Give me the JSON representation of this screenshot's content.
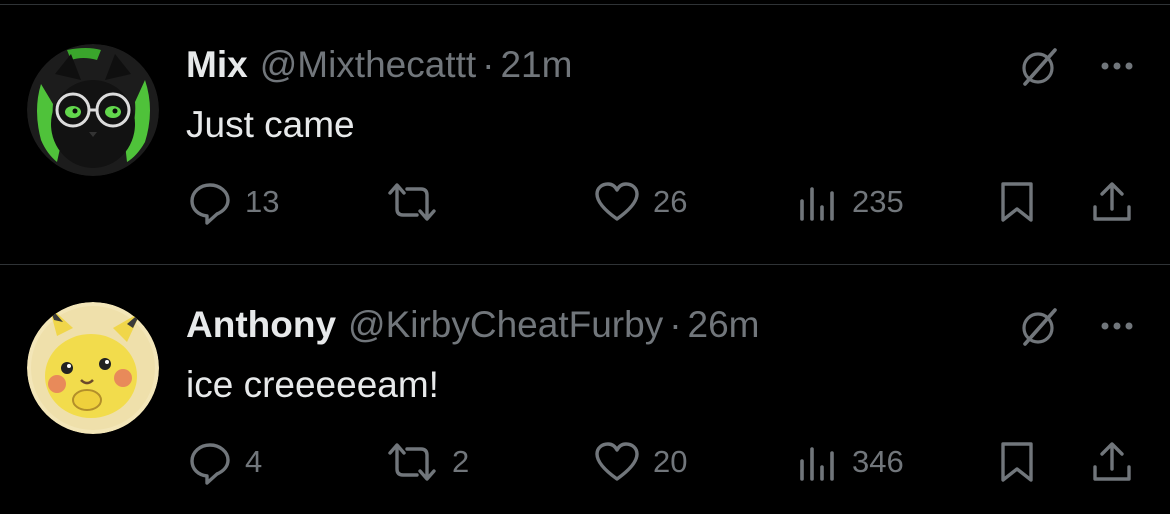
{
  "colors": {
    "background": "#000000",
    "text_primary": "#e7e9ea",
    "text_secondary": "#71767b",
    "divider": "#2f3336"
  },
  "tweets": [
    {
      "display_name": "Mix",
      "handle": "@Mixthecattt",
      "separator": "·",
      "time": "21m",
      "text": "Just came",
      "avatar": "black-cat-with-glasses-avatar",
      "actions": {
        "replies": "13",
        "retweets": "",
        "likes": "26",
        "views": "235"
      }
    },
    {
      "display_name": "Anthony",
      "handle": "@KirbyCheatFurby",
      "separator": "·",
      "time": "26m",
      "text": "ice creeeeeam!",
      "avatar": "pikachu-drawing-avatar",
      "actions": {
        "replies": "4",
        "retweets": "2",
        "likes": "20",
        "views": "346"
      }
    }
  ],
  "icons": {
    "reply": "reply-icon",
    "retweet": "retweet-icon",
    "like": "heart-icon",
    "views": "views-icon",
    "bookmark": "bookmark-icon",
    "share": "share-icon",
    "grok": "grok-icon",
    "more": "more-icon"
  }
}
